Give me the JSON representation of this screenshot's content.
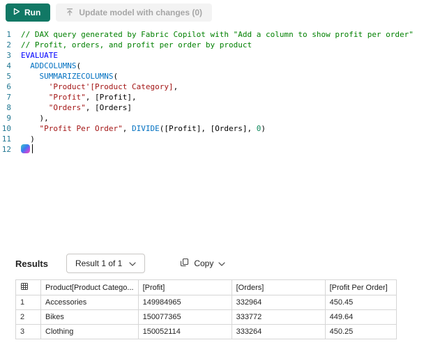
{
  "colors": {
    "run_button": "#117865",
    "comment": "#008000",
    "keyword": "#0000ff",
    "function": "#0070c1",
    "string": "#a31515",
    "line_number": "#237893"
  },
  "toolbar": {
    "run_label": "Run",
    "update_label": "Update model with changes (0)"
  },
  "editor": {
    "lines": [
      {
        "num": "1",
        "tokens": [
          {
            "t": "c",
            "s": "// DAX query generated by Fabric Copilot with \"Add a column to show profit per order\""
          }
        ]
      },
      {
        "num": "2",
        "tokens": [
          {
            "t": "c",
            "s": "// Profit, orders, and profit per order by product"
          }
        ]
      },
      {
        "num": "3",
        "tokens": [
          {
            "t": "k",
            "s": "EVALUATE"
          }
        ]
      },
      {
        "num": "4",
        "tokens": [
          {
            "t": "p",
            "s": "  "
          },
          {
            "t": "f",
            "s": "ADDCOLUMNS"
          },
          {
            "t": "p",
            "s": "("
          }
        ]
      },
      {
        "num": "5",
        "tokens": [
          {
            "t": "p",
            "s": "    "
          },
          {
            "t": "f",
            "s": "SUMMARIZECOLUMNS"
          },
          {
            "t": "p",
            "s": "("
          }
        ]
      },
      {
        "num": "6",
        "tokens": [
          {
            "t": "p",
            "s": "      "
          },
          {
            "t": "s",
            "s": "'Product'[Product Category]"
          },
          {
            "t": "p",
            "s": ","
          }
        ]
      },
      {
        "num": "7",
        "tokens": [
          {
            "t": "p",
            "s": "      "
          },
          {
            "t": "s",
            "s": "\"Profit\""
          },
          {
            "t": "p",
            "s": ", [Profit],"
          }
        ]
      },
      {
        "num": "8",
        "tokens": [
          {
            "t": "p",
            "s": "      "
          },
          {
            "t": "s",
            "s": "\"Orders\""
          },
          {
            "t": "p",
            "s": ", [Orders]"
          }
        ]
      },
      {
        "num": "9",
        "tokens": [
          {
            "t": "p",
            "s": "    ),"
          }
        ]
      },
      {
        "num": "10",
        "tokens": [
          {
            "t": "p",
            "s": "    "
          },
          {
            "t": "s",
            "s": "\"Profit Per Order\""
          },
          {
            "t": "p",
            "s": ", "
          },
          {
            "t": "f",
            "s": "DIVIDE"
          },
          {
            "t": "p",
            "s": "([Profit], [Orders], "
          },
          {
            "t": "n",
            "s": "0"
          },
          {
            "t": "p",
            "s": ")"
          }
        ]
      },
      {
        "num": "11",
        "tokens": [
          {
            "t": "p",
            "s": "  )"
          }
        ]
      },
      {
        "num": "12",
        "tokens": [],
        "copilot": true
      }
    ]
  },
  "results": {
    "title": "Results",
    "result_selector": "Result 1 of 1",
    "copy_label": "Copy",
    "table": {
      "columns": [
        "Product[Product Catego...",
        "[Profit]",
        "[Orders]",
        "[Profit Per Order]"
      ],
      "rows": [
        {
          "num": "1",
          "cells": [
            "Accessories",
            "149984965",
            "332964",
            "450.45"
          ]
        },
        {
          "num": "2",
          "cells": [
            "Bikes",
            "150077365",
            "333772",
            "449.64"
          ]
        },
        {
          "num": "3",
          "cells": [
            "Clothing",
            "150052114",
            "333264",
            "450.25"
          ]
        }
      ]
    }
  }
}
